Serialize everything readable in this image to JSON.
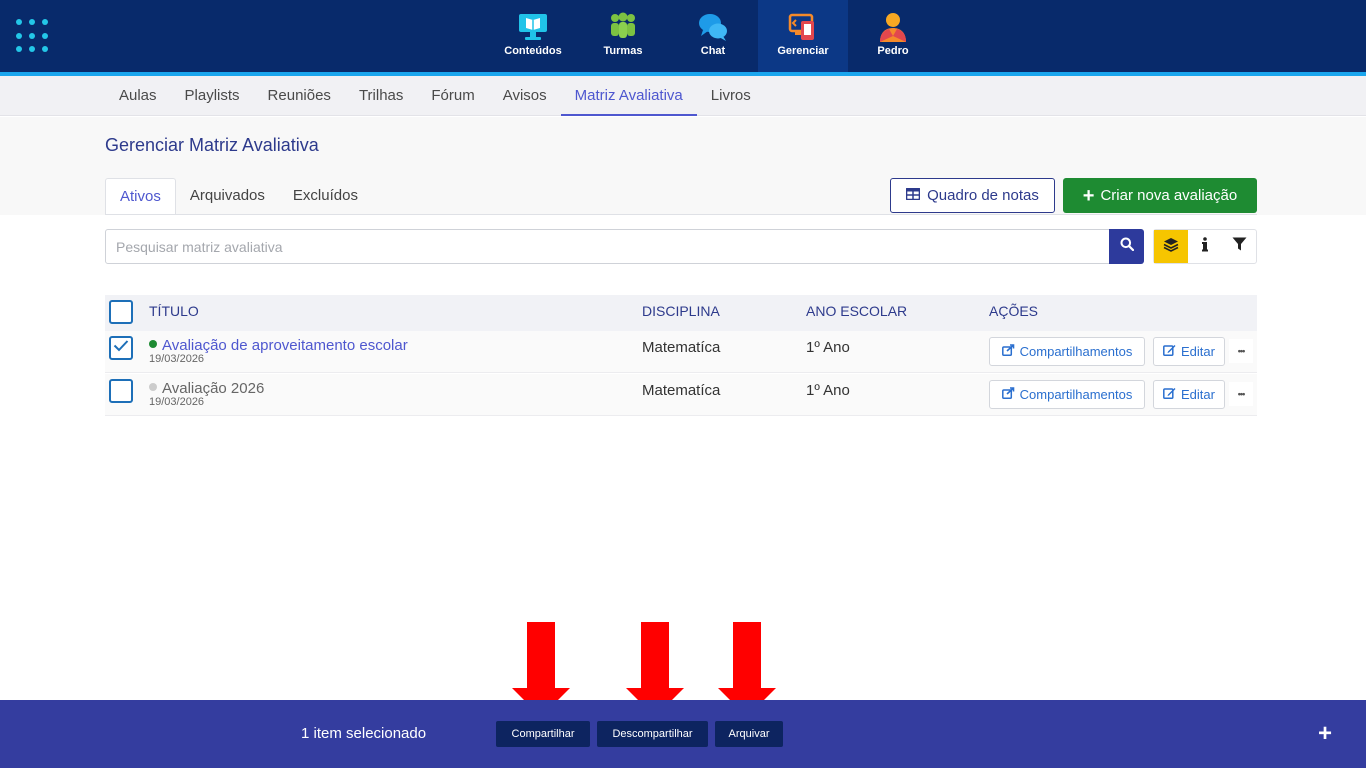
{
  "topnav": {
    "items": [
      {
        "label": "Conteúdos",
        "icon": "monitor-book-icon"
      },
      {
        "label": "Turmas",
        "icon": "people-icon"
      },
      {
        "label": "Chat",
        "icon": "chat-bubbles-icon"
      },
      {
        "label": "Gerenciar",
        "icon": "manage-devices-icon"
      },
      {
        "label": "Pedro",
        "icon": "user-avatar-icon"
      }
    ],
    "active": "Gerenciar"
  },
  "subnav": {
    "items": [
      "Aulas",
      "Playlists",
      "Reuniões",
      "Trilhas",
      "Fórum",
      "Avisos",
      "Matriz Avaliativa",
      "Livros"
    ],
    "active": "Matriz Avaliativa"
  },
  "page": {
    "title": "Gerenciar Matriz Avaliativa"
  },
  "tabs": {
    "items": [
      "Ativos",
      "Arquivados",
      "Excluídos"
    ],
    "active": "Ativos"
  },
  "actions": {
    "quadro_label": "Quadro de notas",
    "criar_label": "Criar nova avaliação"
  },
  "search": {
    "placeholder": "Pesquisar matriz avaliativa"
  },
  "table": {
    "columns": [
      "TÍTULO",
      "DISCIPLINA",
      "ANO ESCOLAR",
      "AÇÕES"
    ],
    "share_label": "Compartilhamentos",
    "edit_label": "Editar",
    "more_label": "•••",
    "rows": [
      {
        "title": "Avaliação de aproveitamento escolar",
        "date": "19/03/2026",
        "disciplina": "Matematíca",
        "ano": "1º Ano",
        "checked": true,
        "status_color": "#1e8b32"
      },
      {
        "title": "Avaliação 2026",
        "date": "19/03/2026",
        "disciplina": "Matematíca",
        "ano": "1º Ano",
        "checked": false,
        "status_color": "#cccccc"
      }
    ]
  },
  "bottombar": {
    "selected_text": "1 item selecionado",
    "buttons": [
      "Compartilhar",
      "Descompartilhar",
      "Arquivar"
    ],
    "plus": "+"
  },
  "colors": {
    "topbar": "#082a6b",
    "accent": "#4e57cf",
    "primary_green": "#1e8b32",
    "bottombar": "#343d9f",
    "arrow": "#ff0000"
  }
}
